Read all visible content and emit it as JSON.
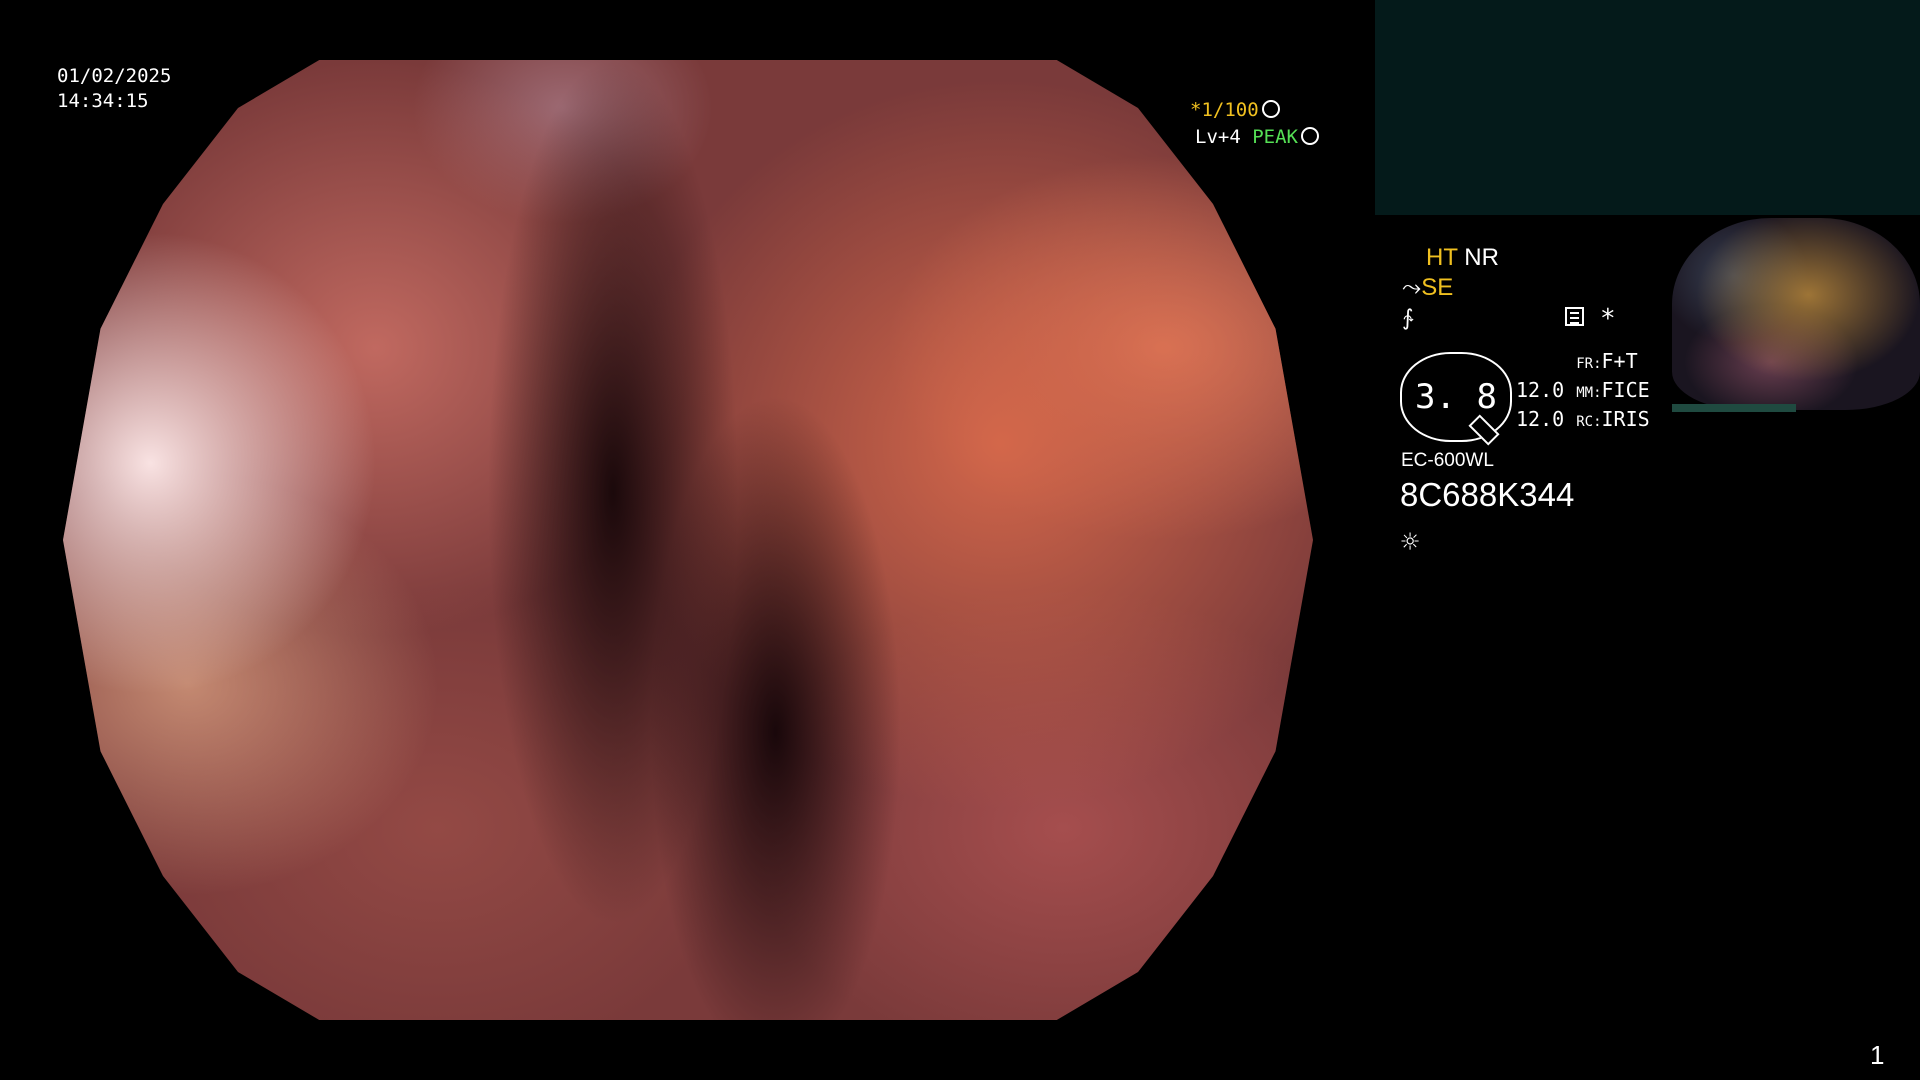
{
  "overlay": {
    "date": "01/02/2025",
    "time": "14:34:15",
    "shutter": "*1/100",
    "level": "Lv+4",
    "peak": "PEAK"
  },
  "panel": {
    "ht": "HT",
    "nr": "NR",
    "se": "SE",
    "star": "*",
    "zoom_value": "3. 8",
    "param_values": [
      "12.0",
      "12.0"
    ],
    "fr_label": "FR:",
    "fr_value": "F+T",
    "mm_label": "MM:",
    "mm_value": "FICE",
    "rc_label": "RC:",
    "rc_value": "IRIS",
    "model": "EC-600WL",
    "serial": "8C688K344"
  },
  "footer": {
    "page_number": "1"
  },
  "colors": {
    "highlight": "#f0c020",
    "peak": "#55e055",
    "top_panel": "#041a1a"
  },
  "icons": [
    "aperture-icon",
    "lens-icon",
    "hook-icon",
    "menu-icon",
    "sun-icon"
  ]
}
